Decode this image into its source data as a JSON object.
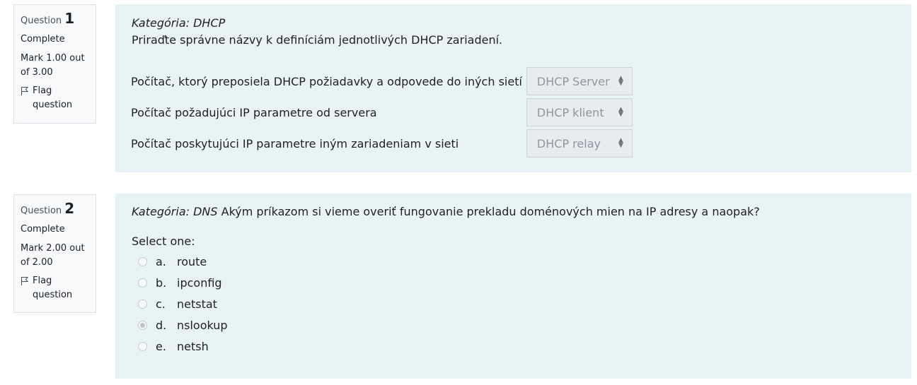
{
  "questions": [
    {
      "label": "Question",
      "number": "1",
      "state": "Complete",
      "grade": "Mark 1.00 out of 3.00",
      "flag": "Flag question",
      "category": "Kategória: DHCP",
      "text": "Priraďte správne názvy k definíciám jednotlivých DHCP zariadení.",
      "rows": [
        {
          "prompt": "Počítač, ktorý preposiela DHCP požiadavky a odpovede do iných sietí",
          "selected": "DHCP Server"
        },
        {
          "prompt": "Počítač požadujúci IP parametre od servera",
          "selected": "DHCP klient"
        },
        {
          "prompt": "Počítač poskytujúci IP parametre iným zariadeniam v sieti",
          "selected": "DHCP relay"
        }
      ]
    },
    {
      "label": "Question",
      "number": "2",
      "state": "Complete",
      "grade": "Mark 2.00 out of 2.00",
      "flag": "Flag question",
      "category": "Kategória: DNS",
      "text": "Akým príkazom si vieme overiť fungovanie prekladu doménových mien na IP adresy a naopak?",
      "select_one": "Select one:",
      "options": [
        {
          "letter": "a.",
          "label": "route",
          "checked": false
        },
        {
          "letter": "b.",
          "label": "ipconfig",
          "checked": false
        },
        {
          "letter": "c.",
          "label": "netstat",
          "checked": false
        },
        {
          "letter": "d.",
          "label": "nslookup",
          "checked": true
        },
        {
          "letter": "e.",
          "label": "netsh",
          "checked": false
        }
      ]
    }
  ]
}
